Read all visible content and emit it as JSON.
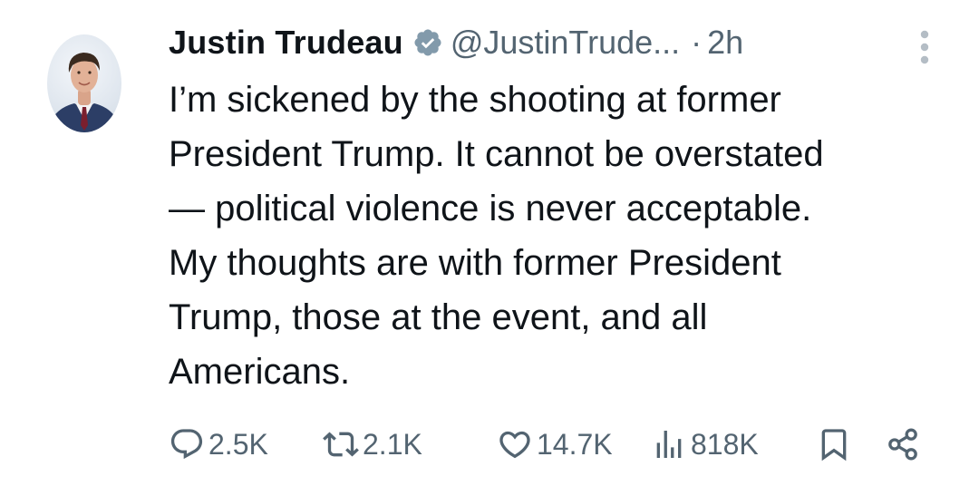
{
  "author": {
    "name": "Justin Trudeau",
    "handle": "@JustinTrude...",
    "separator": "·",
    "time": "2h"
  },
  "tweet": {
    "lines": [
      "I’m sickened by the shooting at former",
      "President Trump. It cannot be overstated",
      "— political violence is never acceptable.",
      "My thoughts are with former President",
      "Trump, those at the event, and all",
      "Americans."
    ]
  },
  "actions": {
    "replies": "2.5K",
    "reposts": "2.1K",
    "likes": "14.7K",
    "views": "818K"
  },
  "icons": {
    "verified": "verified-badge-icon",
    "more": "more-options-icon",
    "reply": "reply-icon",
    "repost": "repost-icon",
    "like": "heart-icon",
    "views": "views-icon",
    "bookmark": "bookmark-icon",
    "share": "share-icon"
  },
  "colors": {
    "text": "#0f1419",
    "secondary": "#536471",
    "verified": "#829aab"
  }
}
